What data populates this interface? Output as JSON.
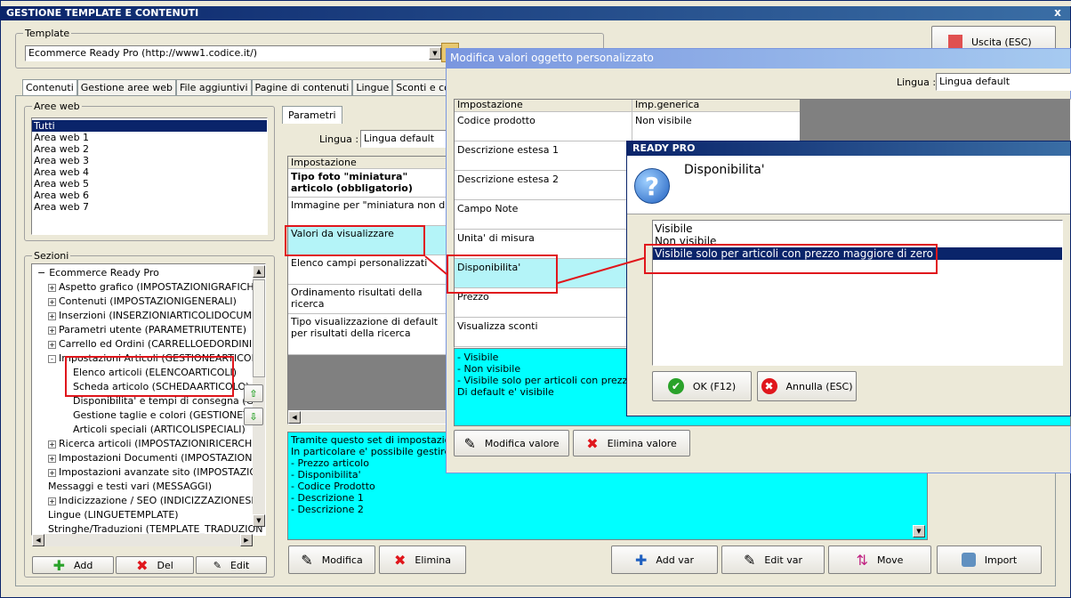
{
  "main_window": {
    "title": "GESTIONE TEMPLATE E CONTENUTI",
    "close_label": "x",
    "exit_button": "Uscita (ESC)",
    "template_group_label": "Template",
    "template_select_value": "Ecommerce Ready Pro (http://www1.codice.it/)"
  },
  "tabs": [
    "Contenuti",
    "Gestione aree web",
    "File aggiuntivi",
    "Pagine di contenuti",
    "Lingue",
    "Sconti e coupon"
  ],
  "aree_web": {
    "label": "Aree web",
    "items": [
      "Tutti",
      "Area web 1",
      "Area web 2",
      "Area web 3",
      "Area web 4",
      "Area web 5",
      "Area web 6",
      "Area web 7"
    ]
  },
  "sezioni": {
    "label": "Sezioni",
    "root": "Ecommerce Ready Pro",
    "items": [
      {
        "text": "Aspetto grafico (IMPOSTAZIONIGRAFICHE)",
        "level": 1,
        "expander": "+"
      },
      {
        "text": "Contenuti (IMPOSTAZIONIGENERALI)",
        "level": 1,
        "expander": "+"
      },
      {
        "text": "Inserzioni (INSERZIONIARTICOLIDOCUMENT",
        "level": 1,
        "expander": "+"
      },
      {
        "text": "Parametri utente (PARAMETRIUTENTE)",
        "level": 1,
        "expander": "+"
      },
      {
        "text": "Carrello ed Ordini (CARRELLOEDORDINI)",
        "level": 1,
        "expander": "+"
      },
      {
        "text": "Impostazioni Articoli (GESTIONEARTICOLIDC",
        "level": 1,
        "expander": "-"
      },
      {
        "text": "Elenco articoli (ELENCOARTICOLI)",
        "level": 2,
        "expander": ""
      },
      {
        "text": "Scheda articolo (SCHEDAARTICOLO)",
        "level": 2,
        "expander": ""
      },
      {
        "text": "Disponibilita' e tempi di consegna (GES",
        "level": 2,
        "expander": ""
      },
      {
        "text": "Gestione taglie e colori (GESTIONETAG",
        "level": 2,
        "expander": ""
      },
      {
        "text": "Articoli speciali (ARTICOLISPECIALI)",
        "level": 2,
        "expander": ""
      },
      {
        "text": "Ricerca articoli (IMPOSTAZIONIRICERCHE)",
        "level": 1,
        "expander": "+"
      },
      {
        "text": "Impostazioni Documenti (IMPOSTAZIONIDOC",
        "level": 1,
        "expander": "+"
      },
      {
        "text": "Impostazioni avanzate sito (IMPOSTAZIONIA",
        "level": 1,
        "expander": "+"
      },
      {
        "text": "Messaggi e testi vari (MESSAGGI)",
        "level": 1,
        "expander": ""
      },
      {
        "text": "Indicizzazione / SEO (INDICIZZAZIONESEO)",
        "level": 1,
        "expander": "+"
      },
      {
        "text": "Lingue (LINGUETEMPLATE)",
        "level": 1,
        "expander": ""
      },
      {
        "text": "Stringhe/Traduzioni (TEMPLATE_TRADUZION",
        "level": 1,
        "expander": ""
      }
    ],
    "add_button": "Add",
    "del_button": "Del",
    "edit_button": "Edit"
  },
  "parametri": {
    "tab_label": "Parametri",
    "lingua_label": "Lingua :",
    "lingua_value": "Lingua default",
    "header": "Impostazione",
    "rows": [
      {
        "text": "Tipo foto \"miniatura\" articolo (obbligatorio)",
        "bold": true
      },
      {
        "text": "Immagine per \"miniatura non disponil",
        "bold": false
      },
      {
        "text": "Valori da visualizzare",
        "bold": false
      },
      {
        "text": "Elenco campi personalizzati",
        "bold": false
      },
      {
        "text": "Ordinamento risultati della ricerca",
        "bold": false
      },
      {
        "text": "Tipo visualizzazione di default per risultati della ricerca",
        "bold": false
      }
    ],
    "description": [
      "Tramite questo set di impostazioni e'",
      "In particolare e' possibile gestire la vi",
      "- Prezzo articolo",
      "- Disponibilita'",
      "- Codice Prodotto",
      "- Descrizione 1",
      "- Descrizione 2"
    ],
    "modifica_button": "Modifica",
    "elimina_button": "Elimina",
    "add_var_button": "Add var",
    "edit_var_button": "Edit var",
    "move_button": "Move",
    "import_button": "Import"
  },
  "modifica_dialog": {
    "title": "Modifica valori oggetto personalizzato",
    "lingua_label": "Lingua :",
    "lingua_value": "Lingua default",
    "col1": "Impostazione",
    "col2": "Imp.generica",
    "rows": [
      {
        "name": "Codice prodotto",
        "value": "Non visibile"
      },
      {
        "name": "Descrizione estesa 1",
        "value": ""
      },
      {
        "name": "Descrizione estesa 2",
        "value": ""
      },
      {
        "name": "Campo Note",
        "value": ""
      },
      {
        "name": "Unita' di misura",
        "value": ""
      },
      {
        "name": "Disponibilita'",
        "value": ""
      },
      {
        "name": "Prezzo",
        "value": ""
      },
      {
        "name": "Visualizza sconti",
        "value": ""
      }
    ],
    "description": [
      "- Visibile",
      "- Non visibile",
      "- Visibile solo per articoli con prezzo mag",
      "Di default e' visibile"
    ],
    "modifica_valore_button": "Modifica valore",
    "elimina_valore_button": "Elimina valore"
  },
  "ready_dialog": {
    "title": "READY PRO",
    "heading": "Disponibilita'",
    "options": [
      "Visibile",
      "Non visibile",
      "Visibile solo per articoli con prezzo maggiore di zero"
    ],
    "selected_index": 2,
    "ok_button": "OK (F12)",
    "annulla_button": "Annulla (ESC)"
  }
}
